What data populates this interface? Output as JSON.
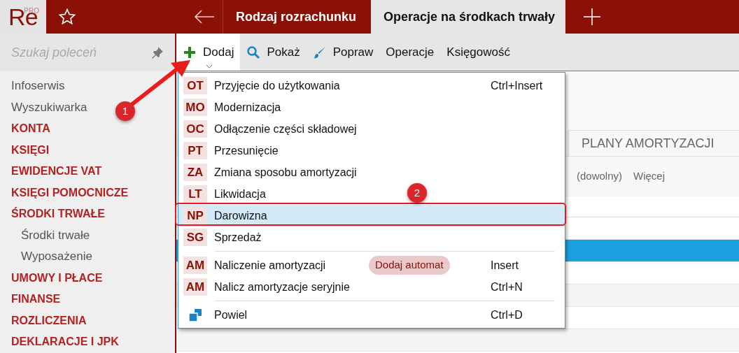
{
  "logo": {
    "text": "Re",
    "superscript": "PRO"
  },
  "tabs": [
    {
      "label": "Rodzaj rozrachunku",
      "selected": false
    },
    {
      "label": "Operacje na środkach trwały",
      "selected": true
    }
  ],
  "search": {
    "placeholder": "Szukaj poleceń"
  },
  "sidebar": {
    "items": [
      {
        "label": "Infoserwis",
        "kind": "link"
      },
      {
        "label": "Wyszukiwarka",
        "kind": "link"
      },
      {
        "label": "KONTA",
        "kind": "section"
      },
      {
        "label": "KSIĘGI",
        "kind": "section"
      },
      {
        "label": "EWIDENCJE VAT",
        "kind": "section"
      },
      {
        "label": "KSIĘGI POMOCNICZE",
        "kind": "section"
      },
      {
        "label": "ŚRODKI TRWAŁE",
        "kind": "section",
        "children": [
          {
            "label": "Środki trwałe"
          },
          {
            "label": "Wyposażenie"
          }
        ]
      },
      {
        "label": "UMOWY I PŁACE",
        "kind": "section"
      },
      {
        "label": "FINANSE",
        "kind": "section"
      },
      {
        "label": "ROZLICZENIA",
        "kind": "section"
      },
      {
        "label": "DEKLARACJE I JPK",
        "kind": "section"
      }
    ]
  },
  "toolbar": [
    {
      "label": "Dodaj",
      "selected": true
    },
    {
      "label": "Pokaż",
      "selected": false
    },
    {
      "label": "Popraw",
      "selected": false
    },
    {
      "label": "Operacje",
      "selected": false
    },
    {
      "label": "Księgowość",
      "selected": false
    }
  ],
  "menu": [
    {
      "kind": "operation",
      "code": "OT",
      "label": "Przyjęcie do użytkowania",
      "shortcut": "Ctrl+Insert",
      "selected": false
    },
    {
      "kind": "operation",
      "code": "MO",
      "label": "Modernizacja",
      "selected": false
    },
    {
      "kind": "operation",
      "code": "OC",
      "label": "Odłączenie części składowej",
      "selected": false
    },
    {
      "kind": "operation",
      "code": "PT",
      "label": "Przesunięcie",
      "selected": false
    },
    {
      "kind": "operation",
      "code": "ZA",
      "label": "Zmiana sposobu amortyzacji",
      "selected": false
    },
    {
      "kind": "operation",
      "code": "LT",
      "label": "Likwidacja",
      "selected": false
    },
    {
      "kind": "operation",
      "code": "NP",
      "label": "Darowizna",
      "selected": true
    },
    {
      "kind": "operation",
      "code": "SG",
      "label": "Sprzedaż",
      "selected": false
    },
    {
      "kind": "separator"
    },
    {
      "kind": "operation",
      "code": "AM",
      "label": "Naliczenie amortyzacji",
      "badge": "Dodaj automat",
      "shortcut": "Insert",
      "selected": false
    },
    {
      "kind": "operation",
      "code": "AM",
      "label": "Nalicz amortyzacje seryjnie",
      "shortcut": "Ctrl+N",
      "selected": false
    },
    {
      "kind": "separator"
    },
    {
      "kind": "copy",
      "label": "Powiel",
      "shortcut": "Ctrl+D",
      "selected": false
    }
  ],
  "content": {
    "tab": "PLANY AMORTYZACJI",
    "filters": [
      "(dowolny)",
      "Więcej"
    ],
    "rows": [
      {
        "selected": false
      },
      {
        "selected": true
      },
      {
        "selected": false
      },
      {
        "selected": false
      },
      {
        "selected": false
      },
      {
        "selected": false
      }
    ]
  },
  "annotations": [
    {
      "label": "1"
    },
    {
      "label": "2"
    }
  ]
}
